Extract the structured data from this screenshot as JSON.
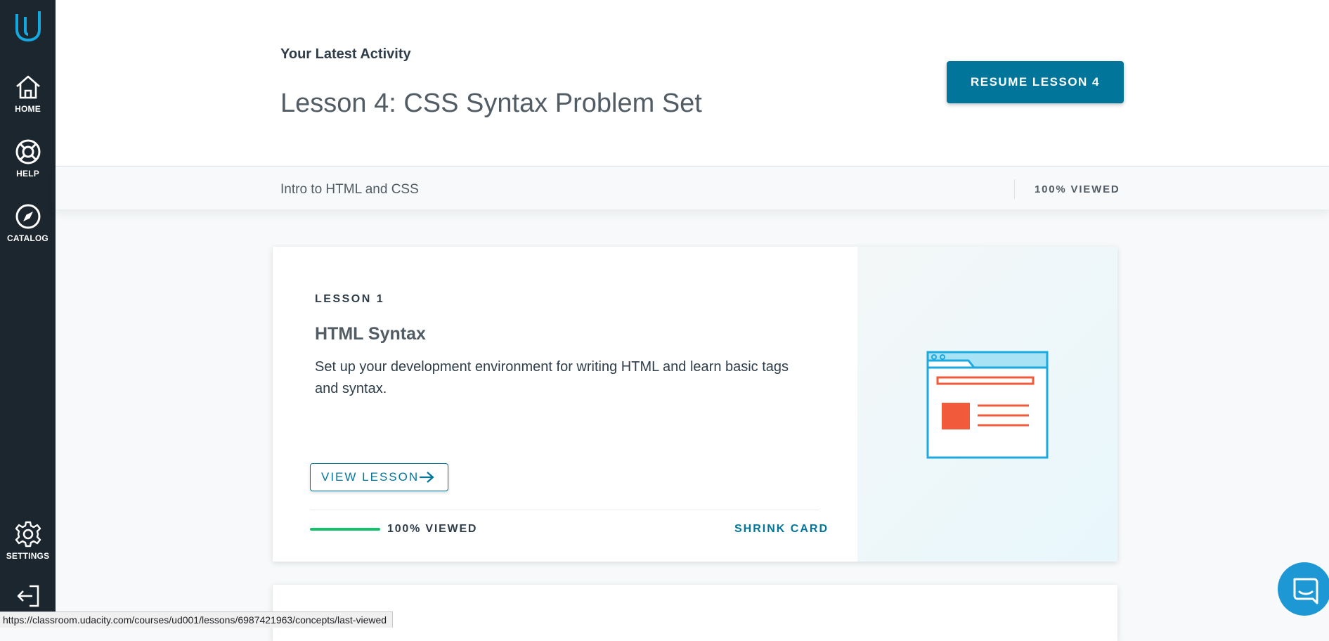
{
  "sidebar": {
    "logo": "udacity-logo-icon",
    "items": [
      {
        "label": "HOME",
        "icon": "home-icon"
      },
      {
        "label": "HELP",
        "icon": "lifebuoy-icon"
      },
      {
        "label": "CATALOG",
        "icon": "compass-icon"
      },
      {
        "label": "SETTINGS",
        "icon": "gear-icon"
      }
    ],
    "logout_icon": "logout-icon"
  },
  "header": {
    "latest_label": "Your Latest Activity",
    "lesson_title": "Lesson 4: CSS Syntax Problem Set",
    "resume_button": "RESUME LESSON 4"
  },
  "course_bar": {
    "course_name": "Intro to HTML and CSS",
    "viewed": "100% VIEWED"
  },
  "card": {
    "lesson_number": "LESSON 1",
    "title": "HTML Syntax",
    "description": "Set up your development environment for writing HTML and learn basic tags and syntax.",
    "view_button": "VIEW LESSON",
    "progress": 1.0,
    "viewed": "100% VIEWED",
    "shrink": "SHRINK CARD",
    "illustration": "browser-window-icon"
  },
  "status_bar": {
    "url": "https://classroom.udacity.com/courses/ud001/lessons/6987421963/concepts/last-viewed"
  },
  "colors": {
    "sidebar_bg": "#1c262f",
    "accent": "#02769a",
    "logo": "#15a8e0",
    "progress": "#15c26b",
    "illustration_red": "#f15a3a",
    "illustration_blue": "#1ca9e0"
  }
}
